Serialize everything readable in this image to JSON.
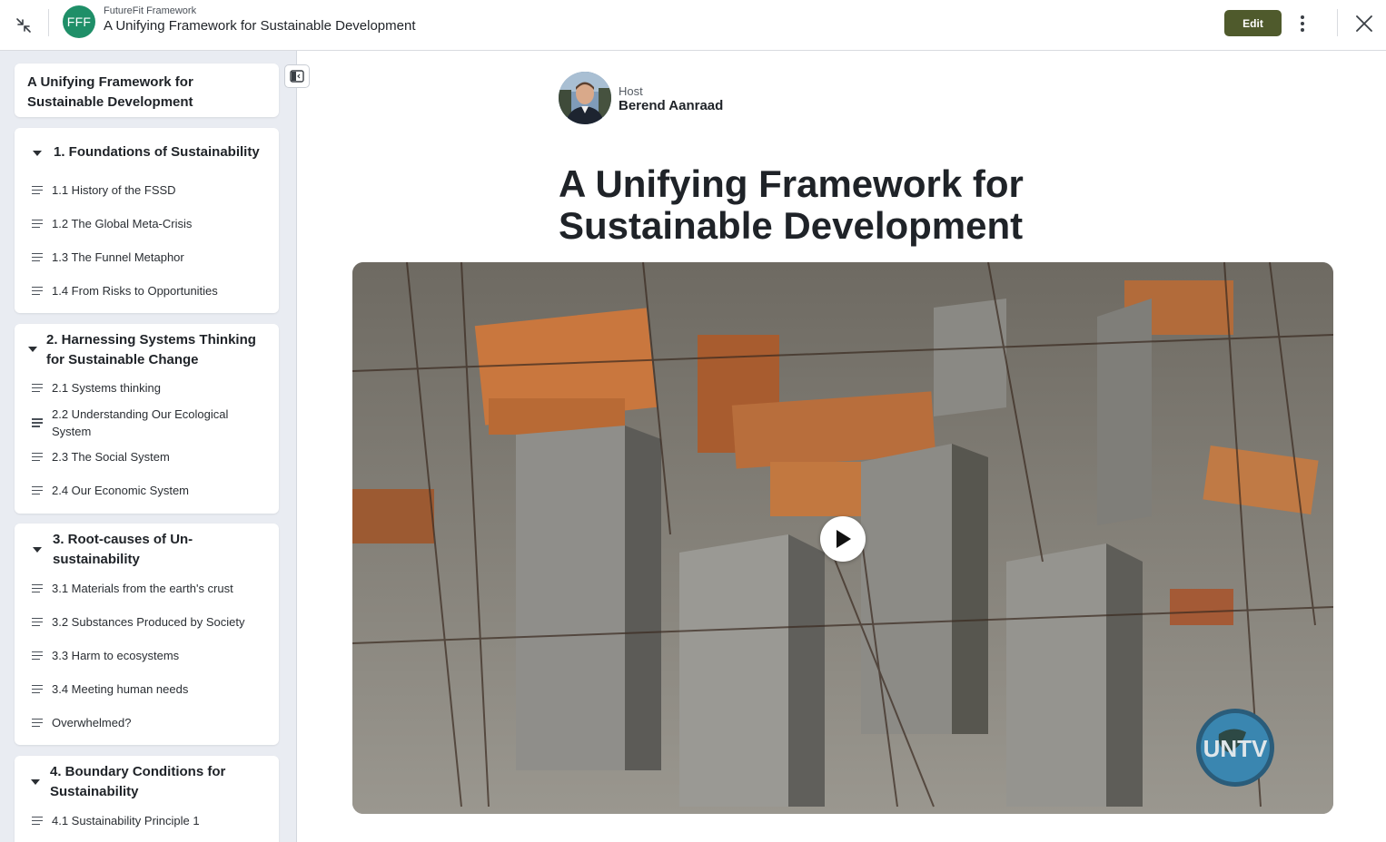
{
  "header": {
    "app_name": "FutureFit Framework",
    "logo_initials": "FFF",
    "document_title": "A Unifying Framework for Sustainable Development",
    "edit_label": "Edit",
    "icons": {
      "collapse": "collapse-arrows-icon",
      "more": "vertical-ellipsis-icon",
      "close": "close-icon"
    },
    "colors": {
      "logo_bg": "#1f8f68",
      "edit_bg": "#4f5a2c"
    }
  },
  "sidebar": {
    "course_title": "A Unifying Framework for Sustainable Development",
    "toggle_icon": "sidebar-panel-icon",
    "chapters": [
      {
        "label": "1. Foundations of Sustainability",
        "expanded": true,
        "lessons": [
          "1.1 History of the FSSD",
          "1.2 The Global Meta-Crisis",
          "1.3 The Funnel Metaphor",
          "1.4 From Risks to Opportunities"
        ]
      },
      {
        "label": "2. Harnessing Systems Thinking for Sustainable Change",
        "expanded": true,
        "lessons": [
          "2.1 Systems thinking",
          "2.2 Understanding Our Ecological System",
          "2.3 The Social System",
          "2.4 Our Economic System"
        ]
      },
      {
        "label": "3. Root-causes of Un-sustainability",
        "expanded": true,
        "lessons": [
          "3.1 Materials from the earth's crust",
          "3.2 Substances Produced by Society",
          "3.3 Harm to ecosystems",
          "3.4 Meeting human needs",
          "Overwhelmed?"
        ]
      },
      {
        "label": "4. Boundary Conditions for Sustainability",
        "expanded": true,
        "lessons": [
          "4.1 Sustainability Principle 1"
        ]
      }
    ]
  },
  "main": {
    "host_label": "Host",
    "host_name": "Berend Aanraad",
    "title": "A Unifying Framework for Sustainable Development",
    "video": {
      "play_icon": "play-icon",
      "watermark": "UNTV"
    }
  }
}
